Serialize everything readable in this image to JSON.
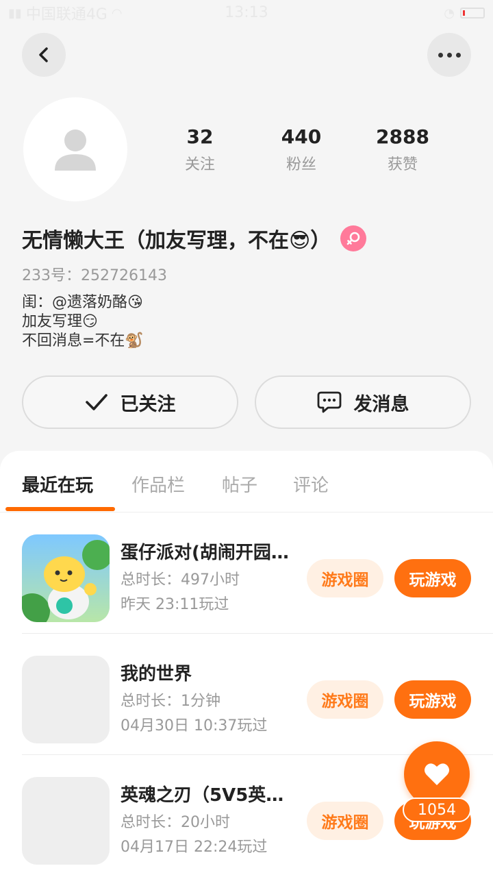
{
  "status_bar": {
    "carrier": "中国联通4G",
    "time": "13:13"
  },
  "profile": {
    "stats": [
      {
        "value": "32",
        "label": "关注"
      },
      {
        "value": "440",
        "label": "粉丝"
      },
      {
        "value": "2888",
        "label": "获赞"
      }
    ],
    "username": "无情懒大王（加友写理，不在😎）",
    "uid": "233号：252726143",
    "bio_lines": [
      "闺：@遗落奶酪😘",
      "加友写理😏",
      "不回消息=不在🐒"
    ]
  },
  "actions": {
    "follow_label": "已关注",
    "message_label": "发消息"
  },
  "tabs": [
    {
      "label": "最近在玩",
      "active": true
    },
    {
      "label": "作品栏",
      "active": false
    },
    {
      "label": "帖子",
      "active": false
    },
    {
      "label": "评论",
      "active": false
    }
  ],
  "games": [
    {
      "name": "蛋仔派对(胡闹开园…",
      "total": "总时长：497小时",
      "last": "昨天 23:11玩过",
      "circle_label": "游戏圈",
      "play_label": "玩游戏"
    },
    {
      "name": "我的世界",
      "total": "总时长：1分钟",
      "last": "04月30日 10:37玩过",
      "circle_label": "游戏圈",
      "play_label": "玩游戏"
    },
    {
      "name": "英魂之刃（5V5英…",
      "total": "总时长：20小时",
      "last": "04月17日 22:24玩过",
      "circle_label": "游戏圈",
      "play_label": "玩游戏"
    }
  ],
  "like": {
    "count": "1054"
  },
  "colors": {
    "accent": "#ff7010",
    "accent_light": "#fff0e3",
    "gender_badge": "#ff7a9a"
  },
  "icons": [
    "back-arrow-icon",
    "more-dots-icon",
    "default-avatar-icon",
    "female-gender-icon",
    "check-icon",
    "chat-bubble-icon",
    "heart-icon"
  ]
}
